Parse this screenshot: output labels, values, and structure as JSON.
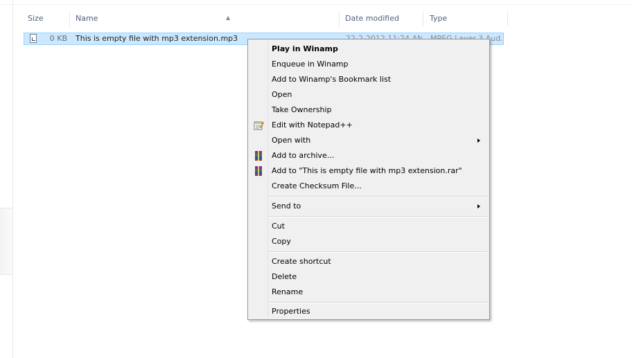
{
  "columns": {
    "size": "Size",
    "name": "Name",
    "date_modified": "Date modified",
    "type": "Type"
  },
  "file": {
    "size": "0 KB",
    "name": "This is empty file with mp3 extension.mp3",
    "date_modified": "22-2-2012 11:24 AM",
    "type": "MPEG Layer 3 Aud..."
  },
  "menu": {
    "play": "Play in Winamp",
    "enqueue": "Enqueue in Winamp",
    "bookmark": "Add to Winamp's Bookmark list",
    "open": "Open",
    "take_ownership": "Take Ownership",
    "notepad": "Edit with Notepad++",
    "open_with": "Open with",
    "add_archive": "Add to archive...",
    "add_rar": "Add to \"This is empty file with mp3 extension.rar\"",
    "checksum": "Create Checksum File...",
    "send_to": "Send to",
    "cut": "Cut",
    "copy": "Copy",
    "create_shortcut": "Create shortcut",
    "delete": "Delete",
    "rename": "Rename",
    "properties": "Properties"
  }
}
